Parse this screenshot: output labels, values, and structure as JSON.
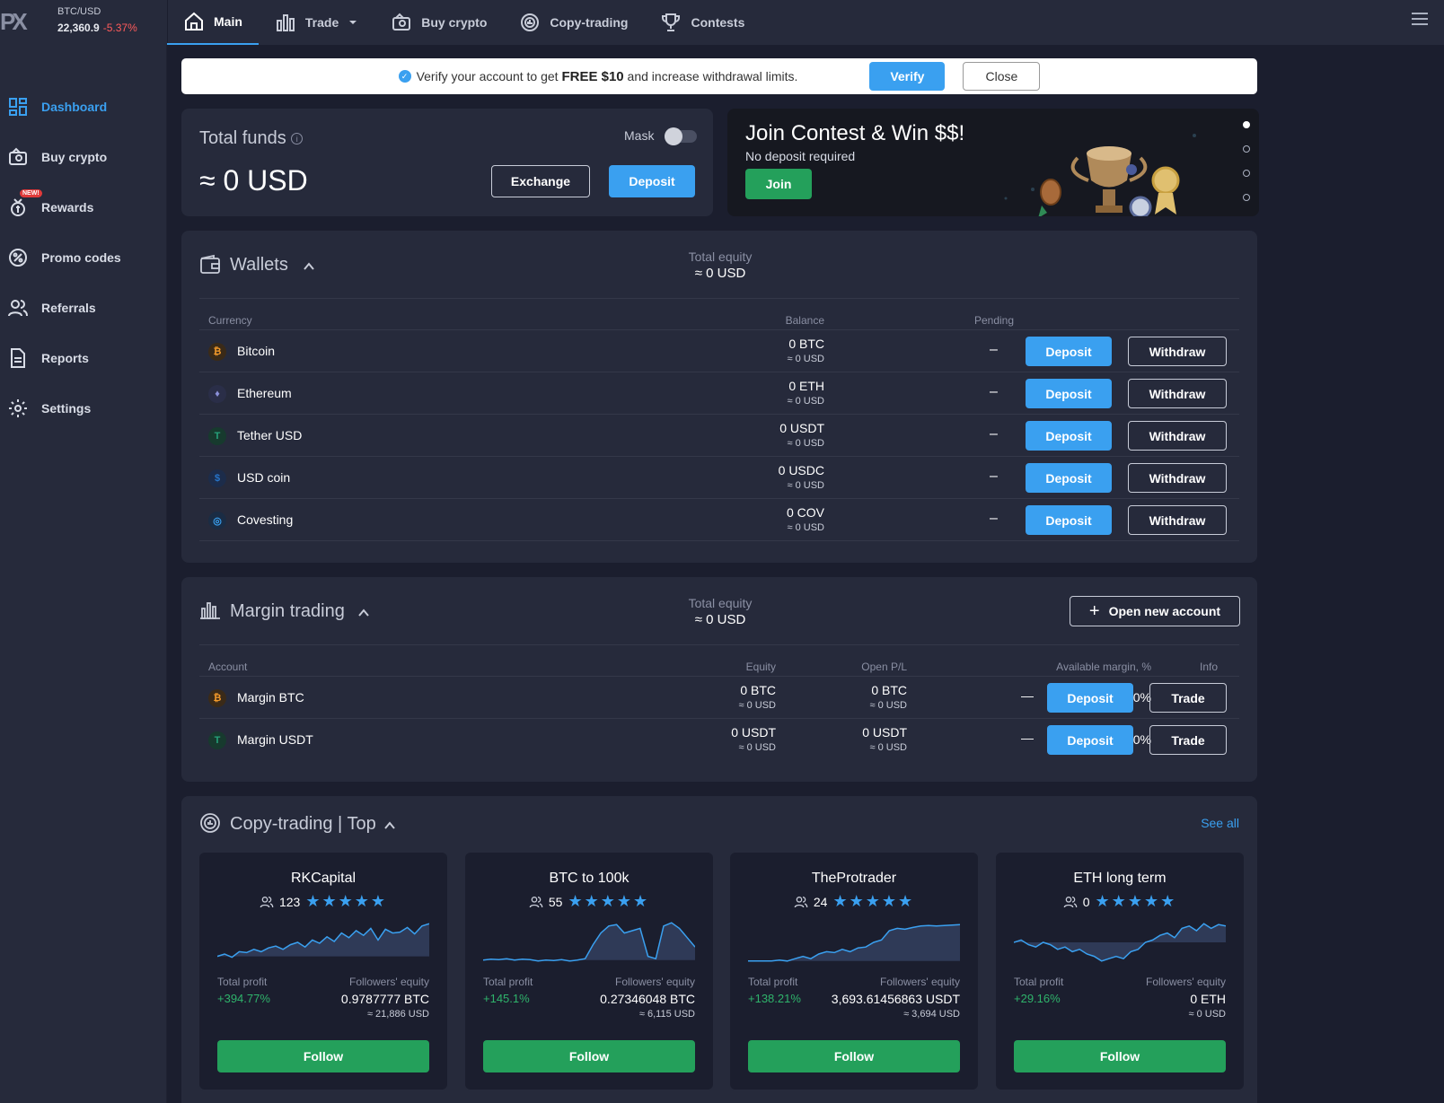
{
  "topbar": {
    "logo": "PX",
    "ticker_pair": "BTC/USD",
    "ticker_price": "22,360.9",
    "ticker_change": "-5.37%",
    "nav": [
      {
        "label": "Main",
        "icon": "home-icon"
      },
      {
        "label": "Trade",
        "icon": "bar-chart-icon"
      },
      {
        "label": "Buy crypto",
        "icon": "wallet-card-icon"
      },
      {
        "label": "Copy-trading",
        "icon": "copy-trading-icon"
      },
      {
        "label": "Contests",
        "icon": "trophy-icon"
      }
    ],
    "menu_icon": "hamburger-icon"
  },
  "sidebar": {
    "items": [
      {
        "label": "Dashboard",
        "icon": "dashboard-icon"
      },
      {
        "label": "Buy crypto",
        "icon": "buy-crypto-icon"
      },
      {
        "label": "Rewards",
        "icon": "rewards-icon",
        "badge": "NEW!"
      },
      {
        "label": "Promo codes",
        "icon": "promo-code-icon"
      },
      {
        "label": "Referrals",
        "icon": "referrals-icon"
      },
      {
        "label": "Reports",
        "icon": "reports-icon"
      },
      {
        "label": "Settings",
        "icon": "gear-icon"
      }
    ]
  },
  "verify_bar": {
    "text_before": "Verify your account to get",
    "highlight": "FREE $10",
    "text_after": "and increase withdrawal limits.",
    "verify_label": "Verify",
    "close_label": "Close"
  },
  "total_funds": {
    "title": "Total funds",
    "value": "≈ 0 USD",
    "mask_label": "Mask",
    "exchange_label": "Exchange",
    "deposit_label": "Deposit"
  },
  "contest": {
    "title": "Join Contest & Win $$!",
    "subtitle": "No deposit required",
    "join_label": "Join",
    "slide_count": 4,
    "active_slide": 1
  },
  "wallets": {
    "title": "Wallets",
    "equity_label": "Total equity",
    "equity_value": "≈ 0 USD",
    "headers": {
      "currency": "Currency",
      "balance": "Balance",
      "pending": "Pending"
    },
    "deposit_label": "Deposit",
    "withdraw_label": "Withdraw",
    "rows": [
      {
        "name": "Bitcoin",
        "symbol": "₿",
        "balance": "0 BTC",
        "usd": "≈ 0 USD",
        "pending": "–"
      },
      {
        "name": "Ethereum",
        "symbol": "♦",
        "balance": "0 ETH",
        "usd": "≈ 0 USD",
        "pending": "–"
      },
      {
        "name": "Tether USD",
        "symbol": "T",
        "balance": "0 USDT",
        "usd": "≈ 0 USD",
        "pending": "–"
      },
      {
        "name": "USD coin",
        "symbol": "$",
        "balance": "0 USDC",
        "usd": "≈ 0 USD",
        "pending": "–"
      },
      {
        "name": "Covesting",
        "symbol": "◎",
        "balance": "0 COV",
        "usd": "≈ 0 USD",
        "pending": "–"
      }
    ]
  },
  "margin": {
    "title": "Margin trading",
    "equity_label": "Total equity",
    "equity_value": "≈ 0 USD",
    "open_account_label": "Open new account",
    "headers": {
      "account": "Account",
      "equity": "Equity",
      "open_pl": "Open P/L",
      "available": "Available margin, %",
      "info": "Info"
    },
    "deposit_label": "Deposit",
    "trade_label": "Trade",
    "rows": [
      {
        "name": "Margin BTC",
        "symbol": "₿",
        "equity": "0 BTC",
        "equity_usd": "≈ 0 USD",
        "pl": "0 BTC",
        "pl_usd": "≈ 0 USD",
        "available": "0%",
        "info": "—"
      },
      {
        "name": "Margin USDT",
        "symbol": "T",
        "equity": "0 USDT",
        "equity_usd": "≈ 0 USD",
        "pl": "0 USDT",
        "pl_usd": "≈ 0 USD",
        "available": "0%",
        "info": "—"
      }
    ]
  },
  "copy_trading": {
    "title": "Copy-trading | Top",
    "see_all_label": "See all",
    "profit_label": "Total profit",
    "equity_label": "Followers' equity",
    "follow_label": "Follow",
    "stars": "★★★★★",
    "cards": [
      {
        "name": "RKCapital",
        "followers": "123",
        "profit": "+394.77%",
        "equity": "0.9787777 BTC",
        "equity_usd": "≈ 21,886 USD",
        "spark": [
          0.2,
          0.25,
          0.18,
          0.3,
          0.28,
          0.35,
          0.3,
          0.38,
          0.42,
          0.35,
          0.45,
          0.5,
          0.4,
          0.55,
          0.48,
          0.62,
          0.52,
          0.7,
          0.6,
          0.75,
          0.65,
          0.8,
          0.55,
          0.78,
          0.7,
          0.72,
          0.82,
          0.68,
          0.85,
          0.9
        ]
      },
      {
        "name": "BTC to 100k",
        "followers": "55",
        "profit": "+145.1%",
        "equity": "0.27346048 BTC",
        "equity_usd": "≈ 6,115 USD",
        "spark": [
          0.12,
          0.14,
          0.13,
          0.15,
          0.12,
          0.14,
          0.13,
          0.1,
          0.12,
          0.11,
          0.13,
          0.1,
          0.12,
          0.15,
          0.45,
          0.7,
          0.85,
          0.88,
          0.7,
          0.75,
          0.8,
          0.2,
          0.15,
          0.85,
          0.92,
          0.8,
          0.6,
          0.4
        ]
      },
      {
        "name": "TheProtrader",
        "followers": "24",
        "profit": "+138.21%",
        "equity": "3,693.61456863 USDT",
        "equity_usd": "≈ 3,694 USD",
        "spark": [
          0.1,
          0.1,
          0.1,
          0.1,
          0.12,
          0.1,
          0.15,
          0.2,
          0.15,
          0.25,
          0.3,
          0.28,
          0.35,
          0.3,
          0.38,
          0.4,
          0.5,
          0.55,
          0.75,
          0.8,
          0.78,
          0.82,
          0.85,
          0.86,
          0.85,
          0.86,
          0.87,
          0.88
        ]
      },
      {
        "name": "ETH long term",
        "followers": "0",
        "profit": "+29.16%",
        "equity": "0 ETH",
        "equity_usd": "≈ 0 USD",
        "spark": [
          0.5,
          0.55,
          0.45,
          0.4,
          0.5,
          0.45,
          0.35,
          0.4,
          0.3,
          0.35,
          0.25,
          0.2,
          0.1,
          0.15,
          0.2,
          0.15,
          0.3,
          0.35,
          0.5,
          0.55,
          0.65,
          0.7,
          0.6,
          0.8,
          0.85,
          0.75,
          0.9,
          0.8,
          0.88,
          0.85
        ]
      }
    ]
  },
  "colors": {
    "accent": "#3aa0f0",
    "follow": "#24a05b",
    "profit": "#2fb36b",
    "negative": "#ff5b5b"
  }
}
